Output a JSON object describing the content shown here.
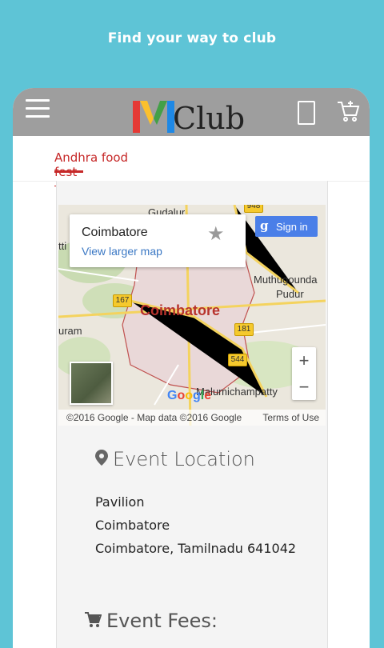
{
  "promo": {
    "text": "Find your way to club"
  },
  "appbar": {
    "logo": {
      "m": "M",
      "club": "Club"
    },
    "icons": [
      "menu-icon",
      "phone-icon",
      "cart-icon"
    ]
  },
  "tabs": [
    {
      "label": "Andhra food fest"
    }
  ],
  "map": {
    "infocard": {
      "title": "Coimbatore",
      "link": "View larger map"
    },
    "signin": {
      "g": "g",
      "label": "Sign in"
    },
    "labels": {
      "gudalur": "Gudalur",
      "muthugounda": "Muthugounda",
      "pudur": "Pudur",
      "uram": "uram",
      "malumichampatty": "Malumichampatty",
      "tti": "tti",
      "city": "Coimbatore"
    },
    "routes": {
      "r948": "948",
      "r167": "167",
      "r181": "181",
      "r544": "544"
    },
    "zoom": {
      "plus": "+",
      "minus": "−"
    },
    "google": "Google",
    "attribution": {
      "left": "©2016 Google - Map data ©2016 Google",
      "right": "Terms of Use"
    }
  },
  "event_location": {
    "heading": "Event Location",
    "lines": [
      "Pavilion",
      "Coimbatore",
      "Coimbatore, Tamilnadu 641042"
    ]
  },
  "event_fees": {
    "heading": "Event Fees:"
  },
  "colors": {
    "background": "#5ec4d6",
    "appbar": "#9e9e9e",
    "accent": "#c62828",
    "link": "#3b78c4"
  }
}
